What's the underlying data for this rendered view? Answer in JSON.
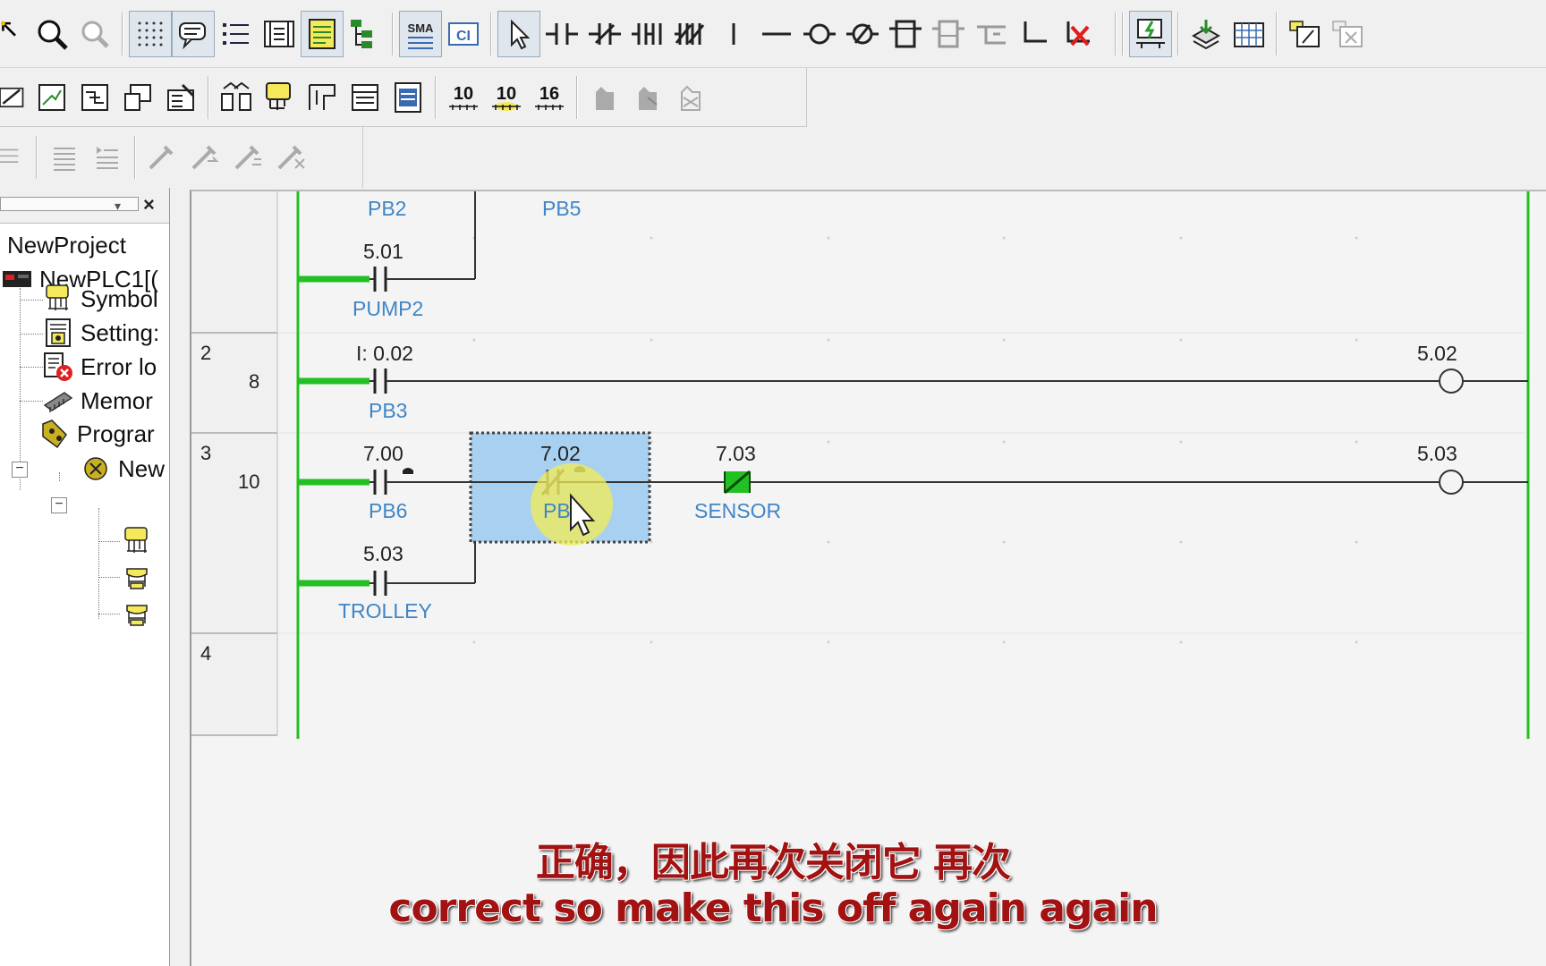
{
  "project_tree": {
    "items": [
      {
        "label": "NewProject",
        "icon": "project-icon"
      },
      {
        "label": "NewPLC1[(",
        "icon": "plc-icon"
      },
      {
        "label": "Symbol",
        "icon": "symbols-icon"
      },
      {
        "label": "Setting:",
        "icon": "settings-icon"
      },
      {
        "label": "Error lo",
        "icon": "error-log-icon"
      },
      {
        "label": "Memor",
        "icon": "memory-icon"
      },
      {
        "label": "Prograr",
        "icon": "programs-icon"
      },
      {
        "label": "New",
        "icon": "program-icon"
      }
    ],
    "expander_minus": "−"
  },
  "toolbar": {
    "num_labels": [
      "10",
      "10",
      "16"
    ],
    "sma_label": "SMA",
    "ci_label": "CI"
  },
  "ladder": {
    "rung1": {
      "top_symbol_left": "PB2",
      "top_symbol_right": "PB5",
      "contact_addr": "5.01",
      "contact_sym": "PUMP2"
    },
    "rung2": {
      "rung_no": "2",
      "step_no": "8",
      "contact_addr": "I: 0.02",
      "contact_sym": "PB3",
      "coil_addr": "5.02"
    },
    "rung3": {
      "rung_no": "3",
      "step_no": "10",
      "contact1_addr": "7.00",
      "contact1_sym": "PB6",
      "contact2_addr": "7.02",
      "contact2_sym": "PB",
      "contact3_addr": "7.03",
      "contact3_sym": "SENSOR",
      "branch_addr": "5.03",
      "branch_sym": "TROLLEY",
      "coil_addr": "5.03"
    },
    "rung4": {
      "rung_no": "4"
    }
  },
  "subtitle": {
    "zh": "正确，因此再次关闭它 再次",
    "en": "correct so make this off again again"
  },
  "colors": {
    "power_flow": "#22c022",
    "symbol_text": "#3f86c6",
    "selection": "#a8d0f0",
    "subtitle": "#a31212"
  }
}
